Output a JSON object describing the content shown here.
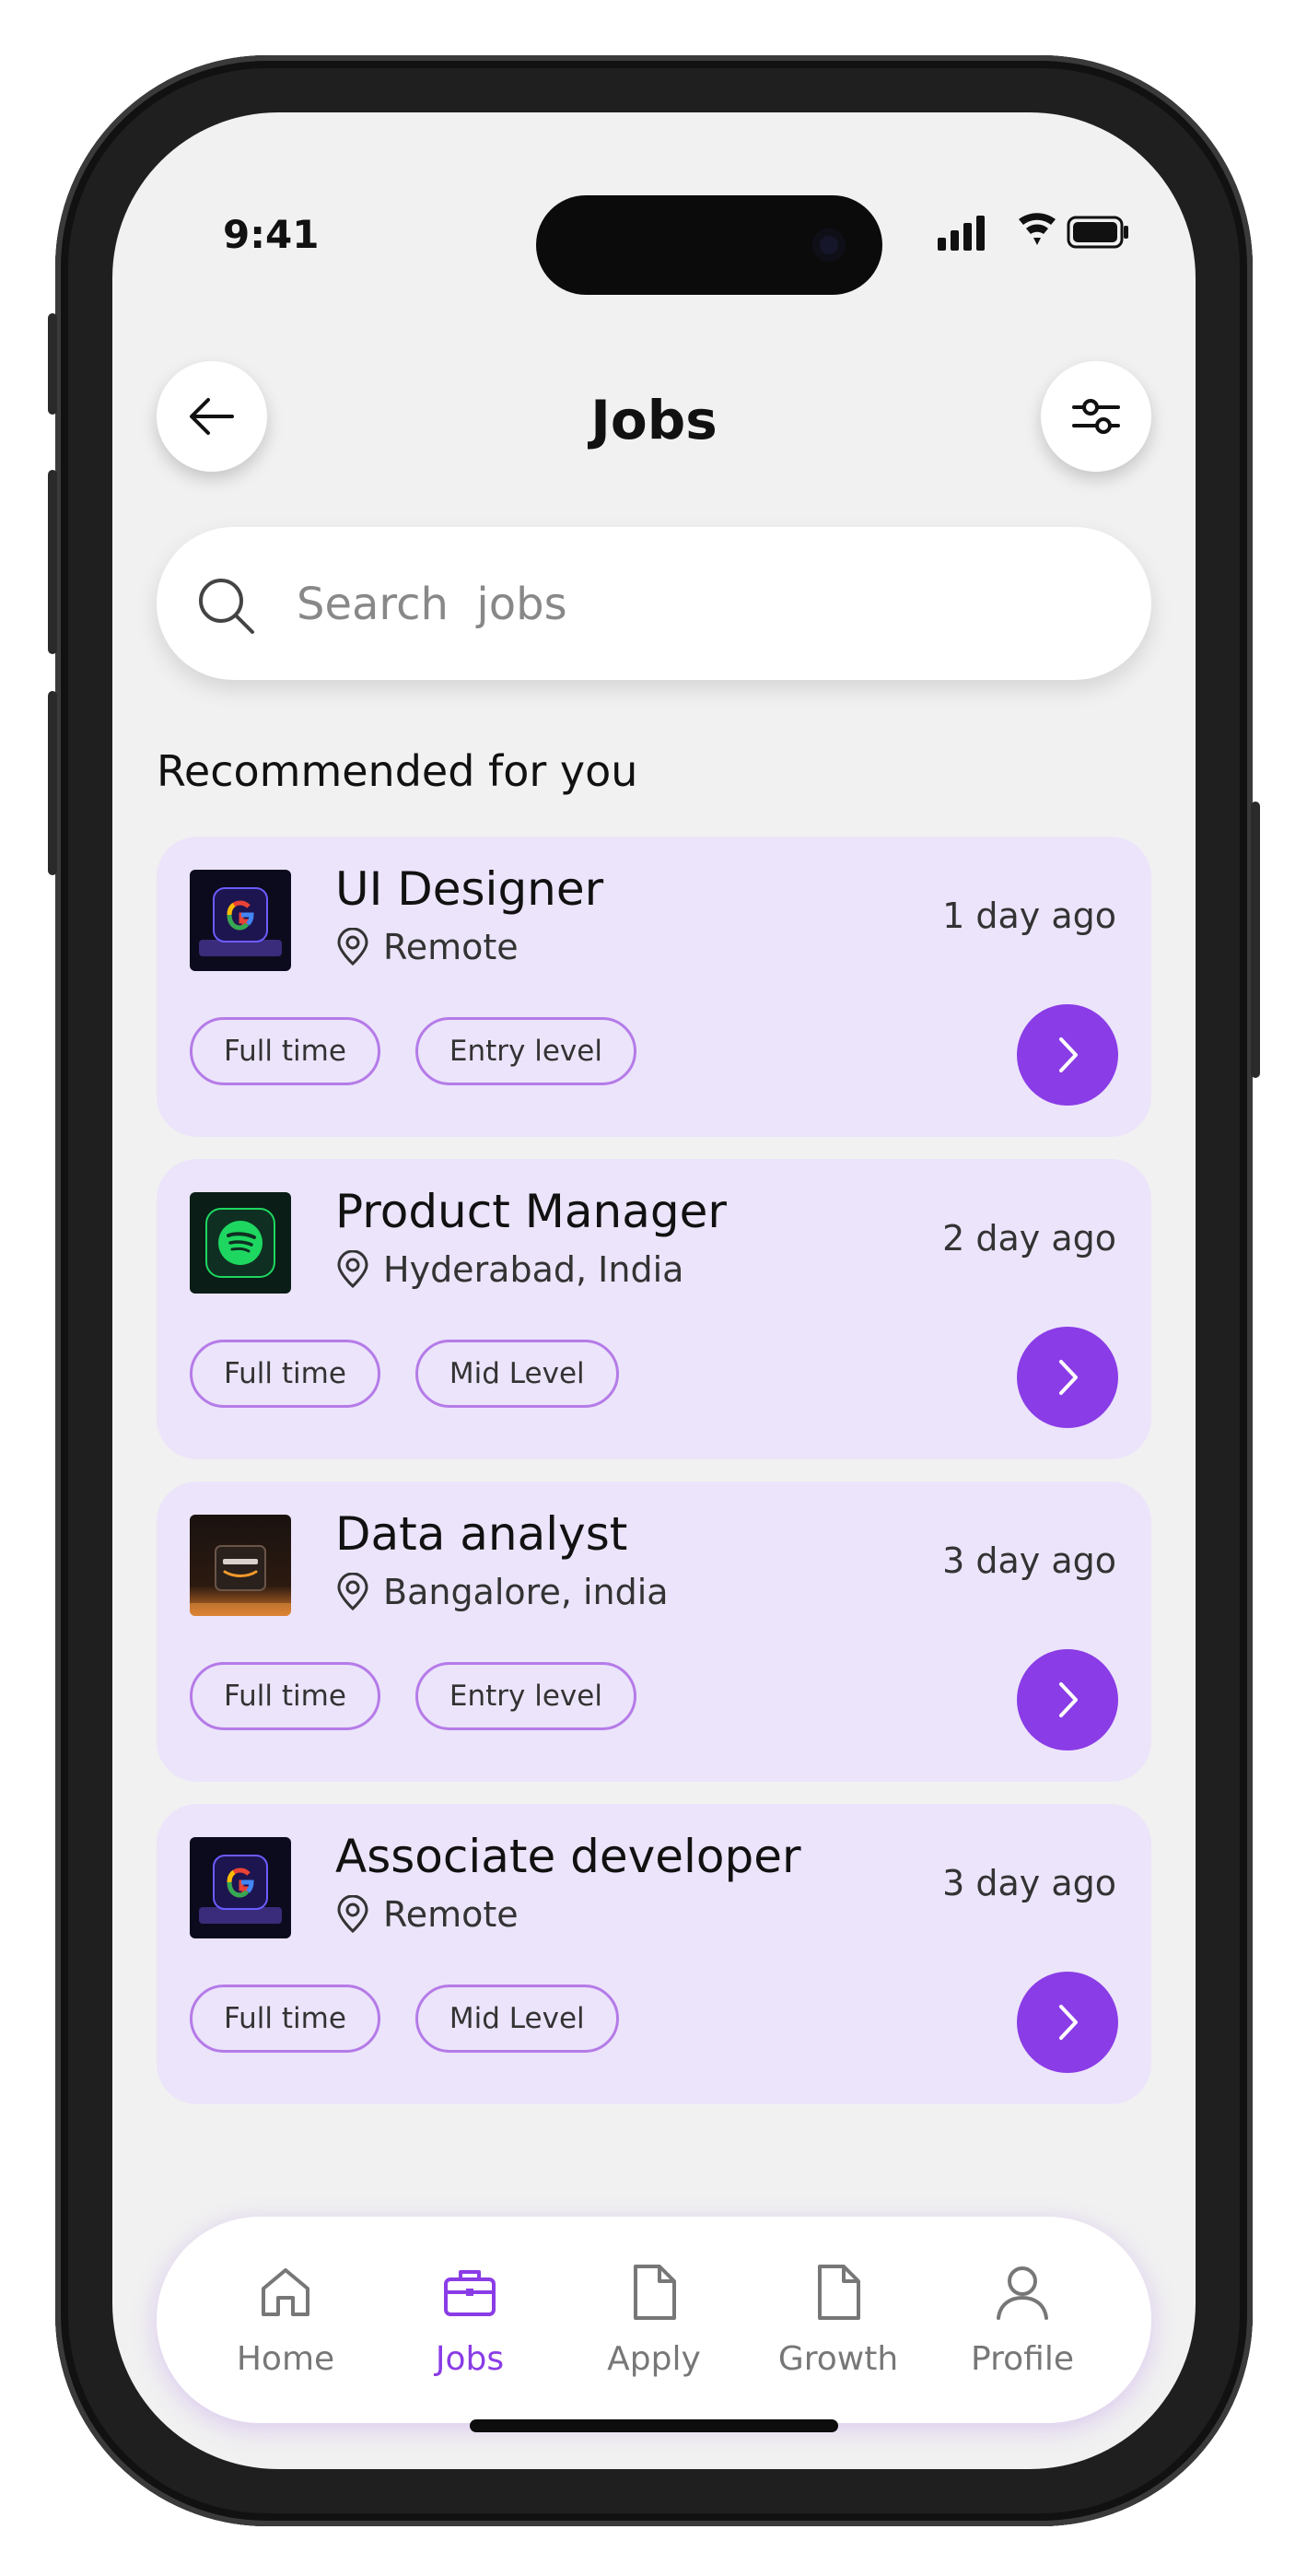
{
  "status_bar": {
    "time": "9:41"
  },
  "header": {
    "title": "Jobs"
  },
  "search": {
    "placeholder": "Search  jobs"
  },
  "section": {
    "title": "Recommended for you"
  },
  "jobs": [
    {
      "title": "UI Designer",
      "location": "Remote",
      "posted": "1 day ago",
      "tags": [
        "Full time",
        "Entry level"
      ],
      "company_logo": "google"
    },
    {
      "title": "Product Manager",
      "location": "Hyderabad, India",
      "posted": "2 day ago",
      "tags": [
        "Full time",
        "Mid Level"
      ],
      "company_logo": "spotify"
    },
    {
      "title": "Data analyst",
      "location": "Bangalore, india",
      "posted": "3 day ago",
      "tags": [
        "Full time",
        "Entry level"
      ],
      "company_logo": "amazon"
    },
    {
      "title": "Associate developer",
      "location": "Remote",
      "posted": "3 day ago",
      "tags": [
        "Full time",
        "Mid Level"
      ],
      "company_logo": "google"
    }
  ],
  "nav": {
    "items": [
      {
        "label": "Home",
        "icon": "home-icon"
      },
      {
        "label": "Jobs",
        "icon": "briefcase-icon",
        "active": true
      },
      {
        "label": "Apply",
        "icon": "document-icon"
      },
      {
        "label": "Growth",
        "icon": "document-icon"
      },
      {
        "label": "Profile",
        "icon": "user-icon"
      }
    ]
  },
  "colors": {
    "accent": "#8a3ce6",
    "card_bg": "#ece4fb",
    "tag_border": "#b57be8",
    "screen_bg": "#f1f1f1"
  }
}
